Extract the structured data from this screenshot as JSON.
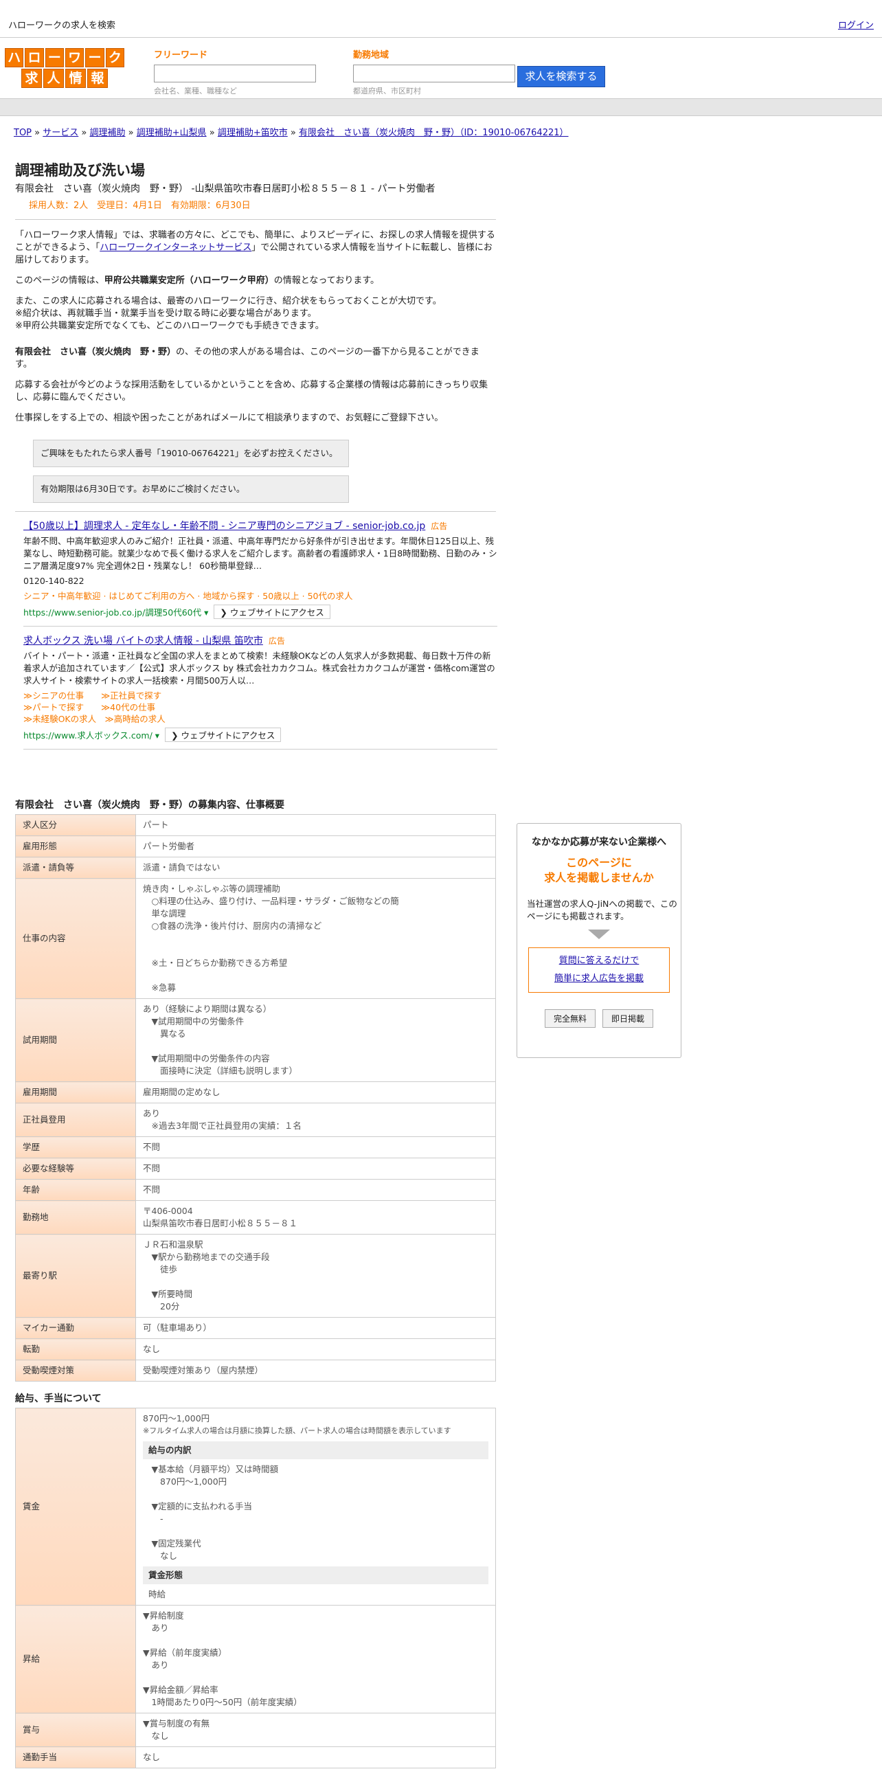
{
  "topbar": {
    "site_title": "ハローワークの求人を検索",
    "login": "ログイン"
  },
  "logo": {
    "row1": [
      "ハ",
      "ロ",
      "ー",
      "ワ",
      "ー",
      "ク"
    ],
    "row2": [
      "求",
      "人",
      "情",
      "報"
    ]
  },
  "search": {
    "freeword_label": "フリーワード",
    "freeword_placeholder": "会社名、業種、職種など",
    "area_label": "勤務地域",
    "area_placeholder": "都道府県、市区町村",
    "button": "求人を検索する"
  },
  "breadcrumb": [
    "TOP",
    "サービス",
    "調理補助",
    "調理補助+山梨県",
    "調理補助+笛吹市",
    "有限会社　さい喜（炭火焼肉　野・野）（ID：19010-06764221）"
  ],
  "job": {
    "title": "調理補助及び洗い場",
    "subtitle": "有限会社　さい喜（炭火焼肉　野・野） -山梨県笛吹市春日居町小松８５５－８１ - パート労働者",
    "meta": "採用人数：2人　受理日：4月1日　有効期限：6月30日"
  },
  "intro": {
    "p1a": "「ハローワーク求人情報」では、求職者の方々に、どこでも、簡単に、よりスピーディに、お探しの求人情報を提供することができるよう、「",
    "p1link": "ハローワークインターネットサービス",
    "p1b": "」で公開されている求人情報を当サイトに転載し、皆様にお届けしております。",
    "p2a": "このページの情報は、",
    "p2b": "甲府公共職業安定所（ハローワーク甲府）",
    "p2c": "の情報となっております。",
    "p3": "また、この求人に応募される場合は、最寄のハローワークに行き、紹介状をもらっておくことが大切です。",
    "p3b": "※紹介状は、再就職手当・就業手当を受け取る時に必要な場合があります。",
    "p3c": "※甲府公共職業安定所でなくても、どこのハローワークでも手続きできます。",
    "p4a": "有限会社　さい喜（炭火焼肉　野・野）",
    "p4b": "の、その他の求人がある場合は、このページの一番下から見ることができます。",
    "p5": "応募する会社が今どのような採用活動をしているかということを含め、応募する企業様の情報は応募前にきっちり収集し、応募に臨んでください。",
    "p6": "仕事探しをする上での、相談や困ったことがあればメールにて相談承りますので、お気軽にご登録下さい。",
    "notice1": "ご興味をもたれたら求人番号「19010-06764221」を必ずお控えください。",
    "notice2": "有効期限は6月30日です。お早めにご検討ください。"
  },
  "ads": [
    {
      "title": "【50歳以上】調理求人 - 定年なし・年齢不問 - シニア専門のシニアジョブ - senior-job.co.jp",
      "tag": "広告",
      "desc": "年齢不問、中高年歓迎求人のみご紹介！正社員・派遣、中高年専門だから好条件が引き出せます。年間休日125日以上、残業なし、時短勤務可能。就業少なめで長く働ける求人をご紹介します。高齢者の看護師求人・1日8時間勤務、日勤のみ・シニア層満足度97% 完全週休2日・残業なし！ 60秒簡単登録…",
      "phone": "0120-140-822",
      "links": "シニア・中高年歓迎 · はじめてご利用の方へ · 地域から探す · 50歳以上 · 50代の求人",
      "url": "https://www.senior-job.co.jp/調理50代60代 ▾",
      "visit": "❯ ウェブサイトにアクセス"
    },
    {
      "title": "求人ボックス 洗い場 バイトの求人情報 - 山梨県 笛吹市",
      "tag": "広告",
      "desc": "バイト・パート・派遣・正社員など全国の求人をまとめて検索！未経験OKなどの人気求人が多数掲載、毎日数十万件の新着求人が追加されています／【公式】求人ボックス by 株式会社カカクコム。株式会社カカクコムが運営・価格com運営の求人サイト・検索サイトの求人一括検索・月間500万人以…",
      "phone": "",
      "links": "≫シニアの仕事　　≫正社員で探す\n≫パートで探す　　≫40代の仕事\n≫未経験OKの求人　≫高時給の求人",
      "url": "https://www.求人ボックス.com/ ▾",
      "visit": "❯ ウェブサイトにアクセス"
    }
  ],
  "section1": {
    "heading": "有限会社　さい喜（炭火焼肉　野・野）の募集内容、仕事概要",
    "rows": [
      {
        "k": "求人区分",
        "v": "パート"
      },
      {
        "k": "雇用形態",
        "v": "パート労働者"
      },
      {
        "k": "派遣・請負等",
        "v": "派遣・請負ではない"
      },
      {
        "k": "仕事の内容",
        "v": "焼き肉・しゃぶしゃぶ等の調理補助\n　○料理の仕込み、盛り付け、一品料理・サラダ・ご飯物などの簡\n　単な調理\n　○食器の洗浄・後片付け、厨房内の清掃など\n\n\n　※土・日どちらか勤務できる方希望\n\n　※急募"
      },
      {
        "k": "試用期間",
        "v": "あり（経験により期間は異なる）\n　▼試用期間中の労働条件\n　　異なる\n\n　▼試用期間中の労働条件の内容\n　　面接時に決定（詳細も説明します）"
      },
      {
        "k": "雇用期間",
        "v": "雇用期間の定めなし"
      },
      {
        "k": "正社員登用",
        "v": "あり\n　※過去3年間で正社員登用の実績：１名"
      },
      {
        "k": "学歴",
        "v": "不問"
      },
      {
        "k": "必要な経験等",
        "v": "不問"
      },
      {
        "k": "年齢",
        "v": "不問"
      },
      {
        "k": "勤務地",
        "v": "〒406-0004\n山梨県笛吹市春日居町小松８５５－８１"
      },
      {
        "k": "最寄り駅",
        "v": "ＪＲ石和温泉駅\n　▼駅から勤務地までの交通手段\n　　徒歩\n\n　▼所要時間\n　　20分"
      },
      {
        "k": "マイカー通勤",
        "v": "可（駐車場あり）"
      },
      {
        "k": "転勤",
        "v": "なし"
      },
      {
        "k": "受動喫煙対策",
        "v": "受動喫煙対策あり（屋内禁煙）"
      }
    ]
  },
  "section2": {
    "heading": "給与、手当について",
    "wage_k": "賃金",
    "wage_main": "870円〜1,000円",
    "wage_note": "※フルタイム求人の場合は月額に換算した額、パート求人の場合は時間額を表示しています",
    "wage_breakdown_title": "給与の内訳",
    "wage_breakdown": "　▼基本給（月額平均）又は時間額\n　　870円〜1,000円\n\n　▼定額的に支払われる手当\n　　-\n\n　▼固定残業代\n　　なし",
    "wage_type_title": "賃金形態",
    "wage_type": "時給",
    "raise_k": "昇給",
    "raise_v": "▼昇給制度\n　あり\n\n▼昇給（前年度実績）\n　あり\n\n▼昇給金額／昇給率\n　1時間あたり0円〜50円（前年度実績）",
    "bonus_k": "賞与",
    "bonus_v": "▼賞与制度の有無\n　なし",
    "commute_k": "通勤手当",
    "commute_v": "なし"
  },
  "side": {
    "title": "なかなか応募が来ない企業様へ",
    "orange1": "このページに",
    "orange2": "求人を掲載しませんか",
    "txt": "当社運営の求人Q-JiNへの掲載で、このページにも掲載されます。",
    "link1": "質問に答えるだけで",
    "link2": "簡単に求人広告を掲載",
    "btn1": "完全無料",
    "btn2": "即日掲載"
  }
}
